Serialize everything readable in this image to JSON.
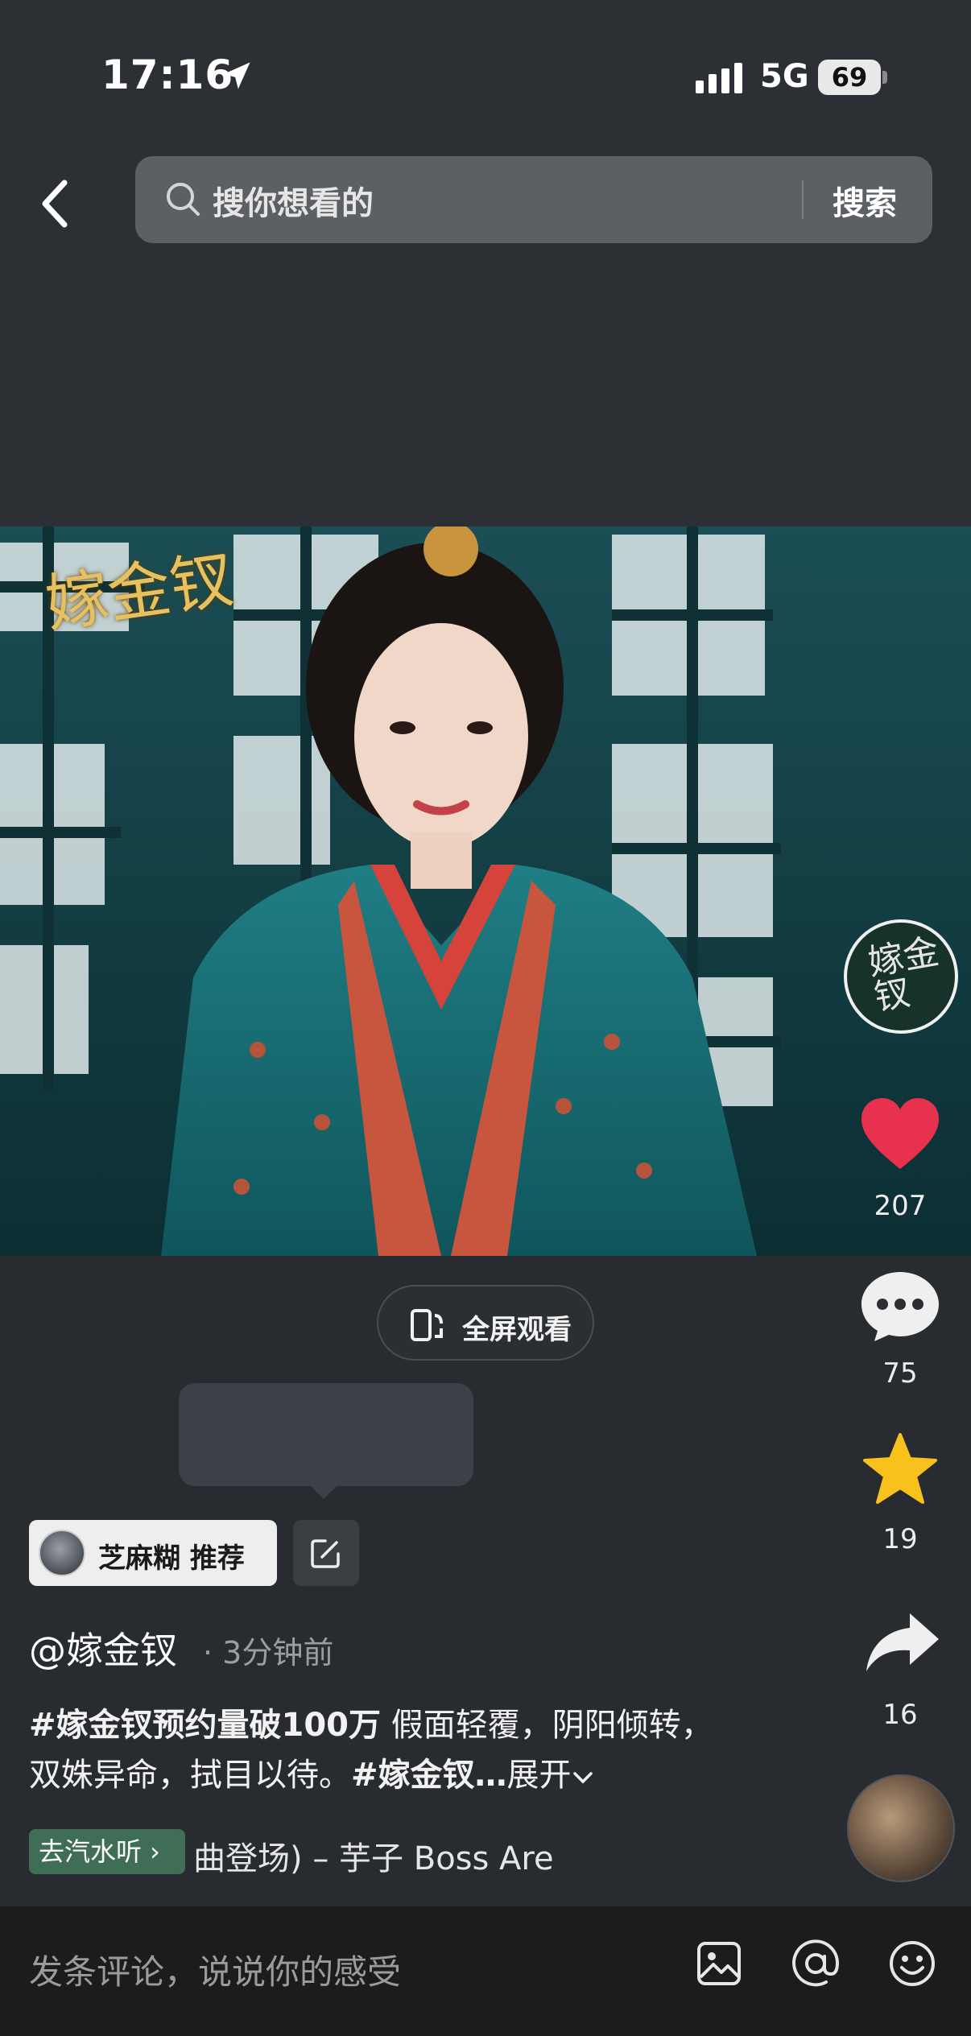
{
  "status_bar": {
    "time": "17:16",
    "network": "5G",
    "battery": "69"
  },
  "search": {
    "placeholder": "搜你想看的",
    "button": "搜索"
  },
  "video": {
    "watermark": "嫁金钗"
  },
  "fullscreen": {
    "label": "全屏观看"
  },
  "recommend": {
    "label": "芝麻糊 推荐"
  },
  "post": {
    "author": "@嫁金钗",
    "time_ago": "· 3分钟前",
    "caption_hashtag": "#嫁金钗预约量破100万",
    "caption_text": " 假面轻覆，阴阳倾转，双姝异命，拭目以待。",
    "caption_hashtag2": "#嫁金钗…",
    "expand": "展开"
  },
  "music": {
    "chip": "去汽水听 ›",
    "text": "曲登场) – 芋子  Boss Are"
  },
  "rail": {
    "disc_logo": "嫁金钗",
    "likes": "207",
    "comments": "75",
    "favorites": "19",
    "shares": "16"
  },
  "bottom_bar": {
    "comment_placeholder": "发条评论，说说你的感受"
  },
  "colors": {
    "like": "#e8314f",
    "favorite": "#f8c11c",
    "music_chip": "#3f6e55"
  },
  "icons": [
    "location-arrow-icon",
    "signal-icon",
    "back-icon",
    "search-icon",
    "fullscreen-icon",
    "edit-icon",
    "heart-icon",
    "comment-icon",
    "star-icon",
    "share-icon",
    "image-icon",
    "at-icon",
    "emoji-icon"
  ]
}
